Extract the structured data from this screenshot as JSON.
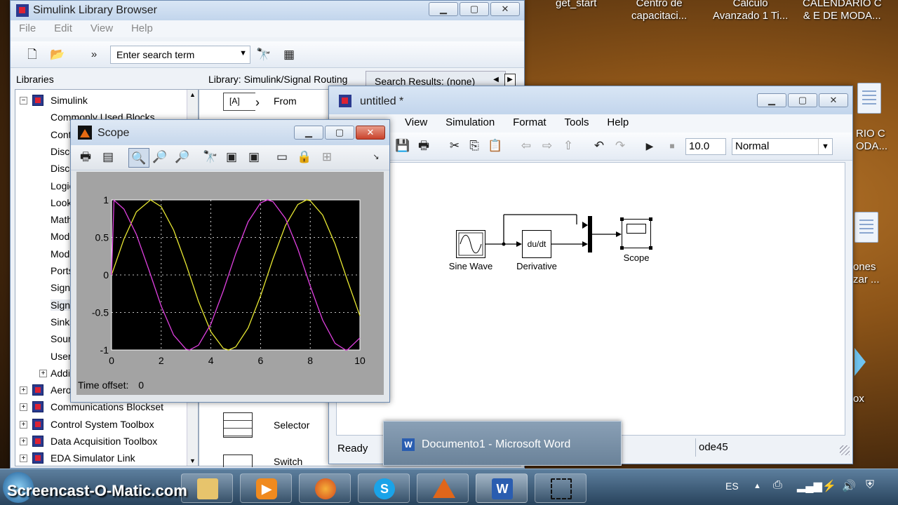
{
  "desktop": {
    "labels": [
      "get_start",
      "Centro de\ncapacitaci...",
      "Calculo\nAvanzado 1 Ti...",
      "CALENDARIO C\n& E DE MODA...",
      "RIO C\nODA...",
      "ones\nzar ...",
      "ox"
    ]
  },
  "library_browser": {
    "title": "Simulink Library Browser",
    "menu": [
      "File",
      "Edit",
      "View",
      "Help"
    ],
    "search_placeholder": "Enter search term",
    "libraries_label": "Libraries",
    "library_path": "Library: Simulink/Signal Routing",
    "search_results": "Search Results: (none)",
    "tree": [
      {
        "label": "Simulink",
        "level": 0,
        "expanded": true
      },
      {
        "label": "Commonly Used Blocks",
        "level": 1
      },
      {
        "label": "Continuous",
        "level": 1
      },
      {
        "label": "Discontinuities",
        "level": 1
      },
      {
        "label": "Discrete",
        "level": 1
      },
      {
        "label": "Logic and Bit Operations",
        "level": 1
      },
      {
        "label": "Lookup Tables",
        "level": 1
      },
      {
        "label": "Math Operations",
        "level": 1
      },
      {
        "label": "Model Verification",
        "level": 1
      },
      {
        "label": "Model-Wide Utilities",
        "level": 1
      },
      {
        "label": "Ports & Subsystems",
        "level": 1
      },
      {
        "label": "Signal Attributes",
        "level": 1
      },
      {
        "label": "Signal Routing",
        "level": 1
      },
      {
        "label": "Sinks",
        "level": 1
      },
      {
        "label": "Sources",
        "level": 1
      },
      {
        "label": "User-Defined Functions",
        "level": 1
      },
      {
        "label": "Additional Math & Discrete",
        "level": 1
      },
      {
        "label": "Aerospace Blockset",
        "level": 0
      },
      {
        "label": "Communications Blockset",
        "level": 0
      },
      {
        "label": "Control System Toolbox",
        "level": 0
      },
      {
        "label": "Data Acquisition Toolbox",
        "level": 0
      },
      {
        "label": "EDA Simulator Link",
        "level": 0
      }
    ],
    "blocks": [
      {
        "icon_text": "[A]",
        "label": "From"
      },
      {
        "icon_text": "",
        "label": "Selector"
      },
      {
        "icon_text": "",
        "label": "Switch"
      }
    ]
  },
  "model": {
    "title": "untitled *",
    "menu": [
      "View",
      "Simulation",
      "Format",
      "Tools",
      "Help"
    ],
    "stop_time": "10.0",
    "sim_mode": "Normal",
    "status_ready": "Ready",
    "solver": "ode45",
    "blocks": {
      "sine": "Sine Wave",
      "derivative": "Derivative",
      "derivative_text": "du/dt",
      "scope": "Scope"
    }
  },
  "scope": {
    "title": "Scope",
    "time_offset_label": "Time offset:",
    "time_offset_value": "0"
  },
  "chart_data": {
    "type": "line",
    "title": "",
    "xlabel": "",
    "ylabel": "",
    "xlim": [
      0,
      10
    ],
    "ylim": [
      -1,
      1
    ],
    "x_ticks": [
      "0",
      "2",
      "4",
      "6",
      "8",
      "10"
    ],
    "y_ticks": [
      "1",
      "0.5",
      "0",
      "-0.5",
      "-1"
    ],
    "grid": true,
    "series": [
      {
        "color": "#e8e832",
        "x": [
          0,
          0.5,
          1,
          1.5708,
          2,
          2.5,
          3,
          3.5,
          4,
          4.5,
          4.7124,
          5,
          5.5,
          6,
          6.5,
          7,
          7.5,
          7.854,
          8,
          8.5,
          9,
          9.5,
          10
        ],
        "values": [
          0,
          0.479,
          0.841,
          1,
          0.909,
          0.598,
          0.141,
          -0.351,
          -0.757,
          -0.978,
          -1,
          -0.959,
          -0.706,
          -0.279,
          0.215,
          0.657,
          0.938,
          1,
          0.989,
          0.798,
          0.412,
          -0.075,
          -0.544
        ]
      },
      {
        "color": "#e040e0",
        "x": [
          0,
          0.1,
          0.5,
          1,
          1.5,
          2,
          2.5,
          3,
          3.1416,
          3.5,
          4,
          4.5,
          5,
          5.5,
          6,
          6.2832,
          6.5,
          7,
          7.5,
          8,
          8.5,
          9,
          9.4248,
          9.5,
          10
        ],
        "values": [
          0,
          0.995,
          0.878,
          0.54,
          0.071,
          -0.416,
          -0.801,
          -0.99,
          -1,
          -0.936,
          -0.654,
          -0.211,
          0.284,
          0.709,
          0.96,
          1,
          0.977,
          0.754,
          0.347,
          -0.146,
          -0.602,
          -0.911,
          -1,
          -0.997,
          -0.839
        ]
      }
    ]
  },
  "taskbar": {
    "watermark": "Screencast-O-Matic.com",
    "popup": "Documento1 - Microsoft Word",
    "language": "ES"
  }
}
